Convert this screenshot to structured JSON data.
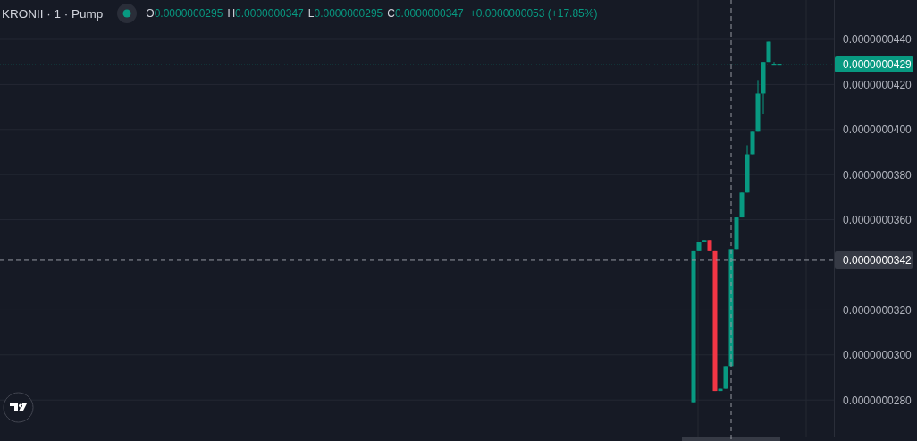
{
  "legend": {
    "symbol": "KRONII · 1 · Pump",
    "ohlc": [
      {
        "label": "O",
        "value": "0.0000000295"
      },
      {
        "label": "H",
        "value": "0.0000000347"
      },
      {
        "label": "L",
        "value": "0.0000000295"
      },
      {
        "label": "C",
        "value": "0.0000000347"
      }
    ],
    "change": "+0.0000000053 (+17.85%)"
  },
  "price_axis": {
    "ticks": [
      "0.0000000440",
      "0.0000000420",
      "0.0000000400",
      "0.0000000380",
      "0.0000000360",
      "0.0000000320",
      "0.0000000300",
      "0.0000000280"
    ]
  },
  "last_price": {
    "label": "0.0000000429"
  },
  "crosshair": {
    "price_label": "0.0000000342"
  }
}
